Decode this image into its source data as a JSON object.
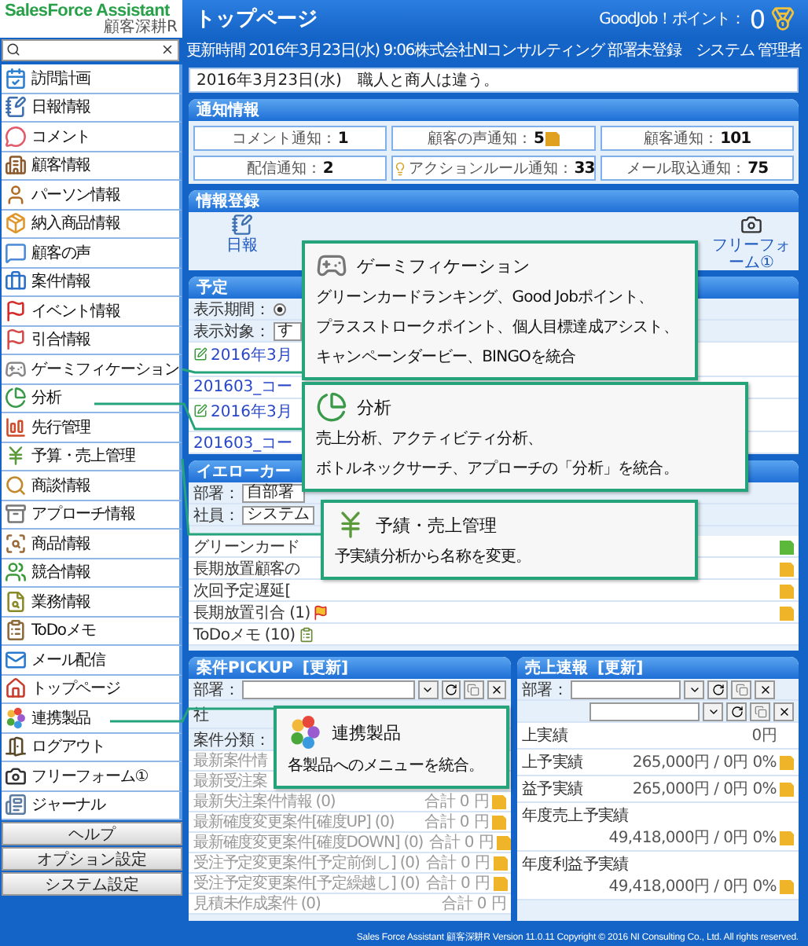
{
  "header": {
    "logo": "SalesForce Assistant",
    "logo_sub": "顧客深耕R",
    "title": "トップページ",
    "points_label": "GoodJob！ポイント：",
    "points": "0",
    "updated": "更新時間 2016年3月23日(水) 9:06",
    "company": "株式会社NIコンサルティング",
    "department": "部署未登録",
    "user": "システム 管理者"
  },
  "sidebar": {
    "items": [
      {
        "label": "訪問計画"
      },
      {
        "label": "日報情報"
      },
      {
        "label": "コメント"
      },
      {
        "label": "顧客情報"
      },
      {
        "label": "パーソン情報"
      },
      {
        "label": "納入商品情報"
      },
      {
        "label": "顧客の声"
      },
      {
        "label": "案件情報"
      },
      {
        "label": "イベント情報"
      },
      {
        "label": "引合情報"
      },
      {
        "label": "ゲーミフィケーション"
      },
      {
        "label": "分析"
      },
      {
        "label": "先行管理"
      },
      {
        "label": "予算・売上管理"
      },
      {
        "label": "商談情報"
      },
      {
        "label": "アプローチ情報"
      },
      {
        "label": "商品情報"
      },
      {
        "label": "競合情報"
      },
      {
        "label": "業務情報"
      },
      {
        "label": "ToDoメモ"
      },
      {
        "label": "メール配信"
      },
      {
        "label": "トップページ"
      },
      {
        "label": "連携製品"
      },
      {
        "label": "ログアウト"
      },
      {
        "label": "フリーフォーム①"
      },
      {
        "label": "ジャーナル"
      }
    ],
    "buttons": [
      "ヘルプ",
      "オプション設定",
      "システム設定"
    ]
  },
  "motto": "2016年3月23日(水)　職人と商人は違う。",
  "notifications": {
    "title": "通知情報",
    "items": [
      {
        "label": "コメント通知：",
        "value": "1",
        "kind": "plain"
      },
      {
        "label": "顧客の声通知：",
        "value": "5",
        "kind": "note"
      },
      {
        "label": "顧客通知：",
        "value": "101",
        "kind": "plain"
      },
      {
        "label": "配信通知：",
        "value": "2",
        "kind": "plain"
      },
      {
        "label": "アクションルール通知：",
        "value": "33",
        "kind": "bulb"
      },
      {
        "label": "メール取込通知：",
        "value": "75",
        "kind": "plain"
      }
    ]
  },
  "registration": {
    "title": "情報登録",
    "items": [
      {
        "label": "日報",
        "kind": "notebook"
      },
      {
        "label": "フリーフォーム①",
        "kind": "camera"
      }
    ]
  },
  "schedule": {
    "title": "予定",
    "period_label": "表示期間：",
    "period_selected": true,
    "target_label": "表示対象：",
    "target_value": "す",
    "entries": [
      {
        "date": "2016年3月",
        "title": "201603_コー"
      },
      {
        "date": "2016年3月",
        "title": "201603_コー"
      }
    ]
  },
  "yellow_card": {
    "title": "イエローカー",
    "department_label": "部署：",
    "department_value": "自部署",
    "staff_label": "社員：",
    "staff_value": "システム",
    "rows": [
      {
        "label": "グリーンカード",
        "kind": "plain",
        "note": true,
        "color": "#5cb83a"
      },
      {
        "label": "長期放置顧客の",
        "kind": "plain",
        "note": true,
        "color": "#f0b428"
      },
      {
        "label": "次回予定遅延[",
        "kind": "plain",
        "note": true,
        "color": "#f0b428"
      },
      {
        "label": "長期放置引合 (1)",
        "kind": "flag",
        "note": true,
        "color": "#f0b428"
      },
      {
        "label": "ToDoメモ (10)",
        "kind": "todo",
        "note": false
      }
    ]
  },
  "pickup": {
    "title": "案件PICKUP",
    "refresh": "[更新]",
    "department_label": "部署：",
    "staff_label": "社",
    "category_label": "案件分類：",
    "rows": [
      {
        "label": "最新案件情"
      },
      {
        "label": "最新受注案"
      },
      {
        "label": "最新失注案件情報 (0)",
        "total": "合計 0 円",
        "note": true
      },
      {
        "label": "最新確度変更案件[確度UP] (0)",
        "total": "合計 0 円",
        "note": true
      },
      {
        "label": "最新確度変更案件[確度DOWN] (0)",
        "total": "合計 0 円",
        "note": true
      },
      {
        "label": "受注予定変更案件[予定前倒し] (0)",
        "total": "合計 0 円",
        "note": true
      },
      {
        "label": "受注予定変更案件[予定繰越し] (0)",
        "total": "合計 0 円",
        "note": true
      },
      {
        "label": "見積未作成案件 (0)",
        "total": "合計 0 円",
        "note": false
      }
    ]
  },
  "sales": {
    "title": "売上速報",
    "refresh": "[更新]",
    "department_label": "部署：",
    "rows": [
      {
        "label": "上実績",
        "value": "0円",
        "note": false
      },
      {
        "label": "上予実績",
        "value": "265,000円 / 0円 0%",
        "note": true
      },
      {
        "label": "益予実績",
        "value": "265,000円 / 0円 0%",
        "note": true
      },
      {
        "label": "年度売上予実績",
        "value": "49,418,000円 / 0円 0%",
        "note": true
      },
      {
        "label": "年度利益予実績",
        "value": "49,418,000円 / 0円 0%",
        "note": true
      }
    ]
  },
  "callouts": [
    {
      "kind": "gamepad",
      "title": "ゲーミフィケーション",
      "lines": [
        "グリーンカードランキング、Good Jobポイント、",
        "プラスストロークポイント、個人目標達成アシスト、",
        "キャンペーンダービー、BINGOを統合"
      ]
    },
    {
      "kind": "pie",
      "title": "分析",
      "lines": [
        "売上分析、アクティビティ分析、",
        "ボトルネックサーチ、アプローチの「分析」を統合。"
      ]
    },
    {
      "kind": "yen",
      "title": "予績・売上管理",
      "lines": [
        "予実績分析から名称を変更。"
      ]
    },
    {
      "kind": "circles",
      "title": "連携製品",
      "lines": [
        "各製品へのメニューを統合。"
      ]
    }
  ],
  "footer": "Sales Force Assistant 顧客深耕R Version 11.0.11 Copyright © 2016 NI Consulting Co., Ltd. All rights reserved."
}
